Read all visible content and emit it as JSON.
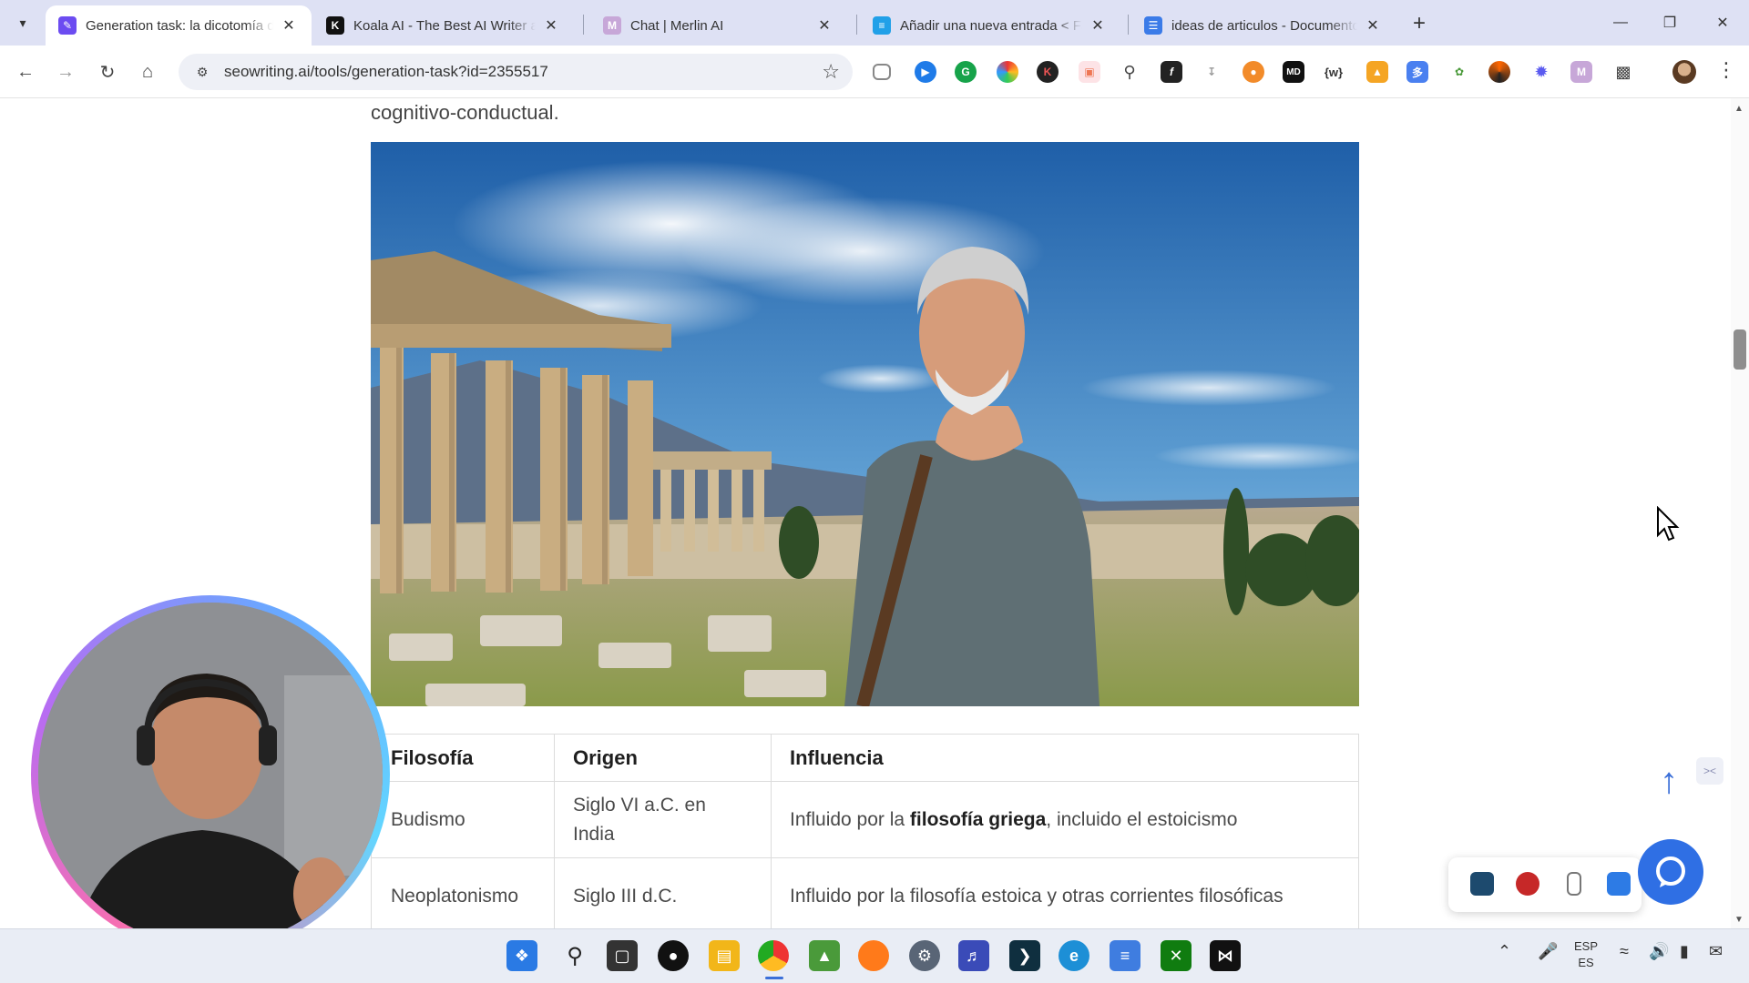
{
  "browser": {
    "tabs": [
      {
        "title": "Generation task: la dicotomía de",
        "favicon": "seowriting-icon",
        "color": "#6c4cf1",
        "active": true
      },
      {
        "title": "Koala AI - The Best AI Writer an",
        "favicon": "koala-icon",
        "color": "#111111",
        "active": false
      },
      {
        "title": "Chat | Merlin AI",
        "favicon": "merlin-icon",
        "color": "#c7a7d8",
        "active": false
      },
      {
        "title": "Añadir una nueva entrada < Fa",
        "favicon": "wordpress-icon",
        "color": "#21a0e8",
        "active": false
      },
      {
        "title": "ideas de articulos - Documento",
        "favicon": "google-docs-icon",
        "color": "#3b7be8",
        "active": false
      }
    ],
    "url": "seowriting.ai/tools/generation-task?id=2355517"
  },
  "article": {
    "intro_text": "cognitivo-conductual.",
    "image_alt": "Hombre mayor frente a ruinas de un templo griego"
  },
  "table": {
    "headers": [
      "Filosofía",
      "Origen",
      "Influencia"
    ],
    "rows": [
      {
        "filosofia": "Budismo",
        "origen": "Siglo VI a.C. en India",
        "influencia_pre": "Influido por la ",
        "influencia_bold": "filosofía griega",
        "influencia_post": ", incluido el estoicismo"
      },
      {
        "filosofia": "Neoplatonismo",
        "origen": "Siglo III d.C.",
        "influencia_pre": "Influido por la filosofía estoica y otras corrientes filosóficas",
        "influencia_bold": "",
        "influencia_post": ""
      }
    ]
  },
  "taskbar": {
    "lang_line1": "ESP",
    "lang_line2": "ES"
  },
  "colors": {
    "tabstrip": "#dee1f4",
    "accent": "#3b6fd8",
    "chat_bubble": "#2f6fe4"
  }
}
